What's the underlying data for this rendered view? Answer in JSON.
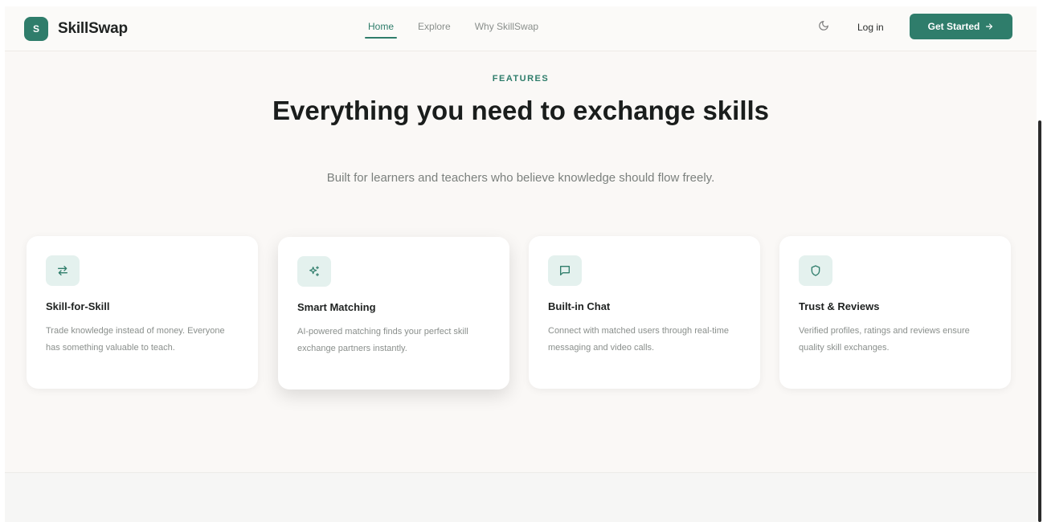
{
  "nav": {
    "brand_initial": "S",
    "brand_name": "SkillSwap",
    "links": [
      {
        "label": "Home",
        "active": true
      },
      {
        "label": "Explore",
        "active": false
      },
      {
        "label": "Why SkillSwap",
        "active": false
      }
    ],
    "theme_icon": "moon-icon",
    "login_label": "Log in",
    "cta_label": "Get Started",
    "cta_icon": "arrow-right-icon"
  },
  "hero": {
    "eyebrow": "FEATURES",
    "title": "Everything you need to exchange skills",
    "subtitle": "Built for learners and teachers who believe knowledge should flow freely."
  },
  "features": [
    {
      "icon": "swap-arrows-icon",
      "title": "Skill-for-Skill",
      "description": "Trade knowledge instead of money. Everyone has something valuable to teach."
    },
    {
      "icon": "sparkles-icon",
      "title": "Smart Matching",
      "description": "AI-powered matching finds your perfect skill exchange partners instantly."
    },
    {
      "icon": "chat-bubble-icon",
      "title": "Built-in Chat",
      "description": "Connect with matched users through real-time messaging and video calls."
    },
    {
      "icon": "shield-icon",
      "title": "Trust & Reviews",
      "description": "Verified profiles, ratings and reviews ensure quality skill exchanges."
    }
  ],
  "colors": {
    "accent": "#2f7d6b",
    "accent_soft": "#e4f1ee",
    "page_bg": "#faf8f6"
  }
}
